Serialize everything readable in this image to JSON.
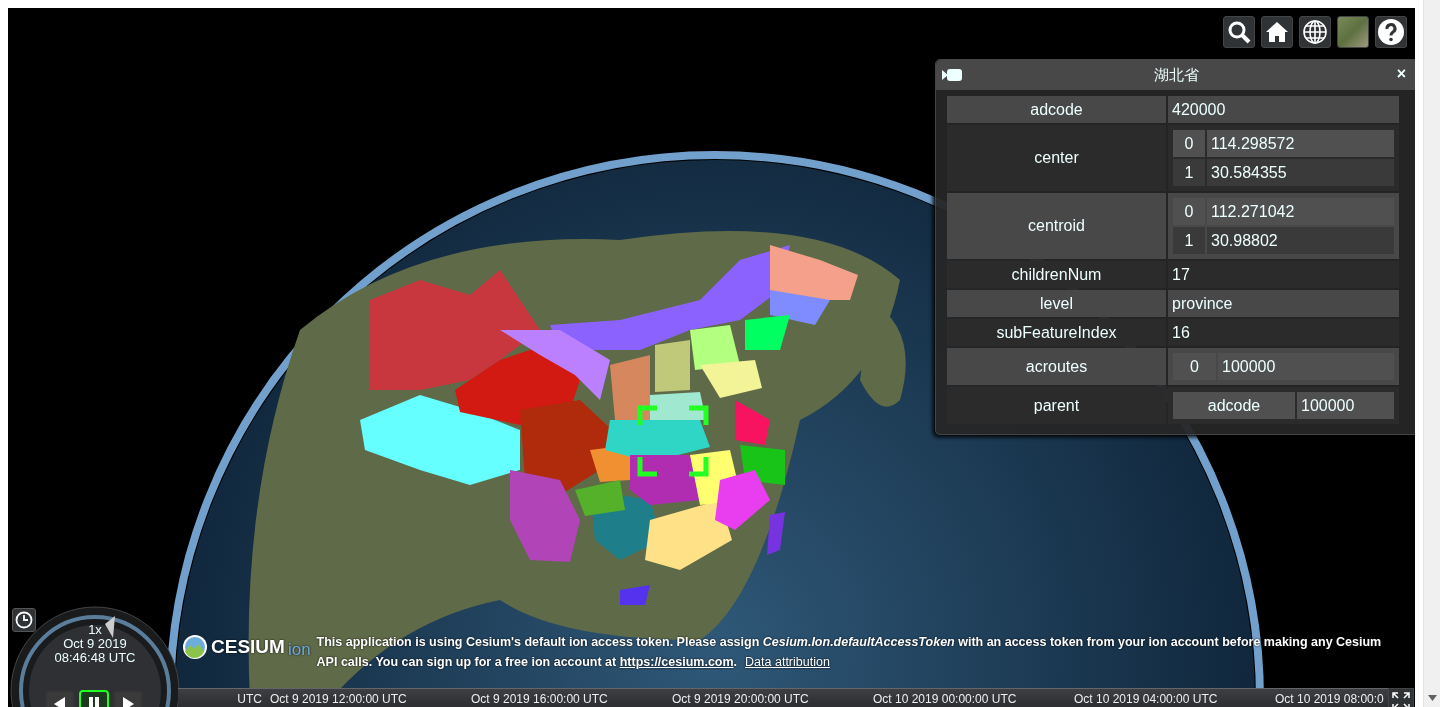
{
  "toolbar": {
    "buttons": [
      {
        "kind": "search"
      },
      {
        "kind": "home"
      },
      {
        "kind": "globe"
      },
      {
        "kind": "imagery"
      },
      {
        "kind": "help"
      }
    ]
  },
  "infobox": {
    "title": "湖北省",
    "close": "×",
    "rows": [
      {
        "kind": "text",
        "key": "adcode",
        "value": "420000"
      },
      {
        "kind": "nested",
        "key": "center",
        "items": [
          {
            "key": "0",
            "value": "114.298572"
          },
          {
            "key": "1",
            "value": "30.584355"
          }
        ]
      },
      {
        "kind": "nested",
        "key": "centroid",
        "items": [
          {
            "key": "0",
            "value": "112.271042"
          },
          {
            "key": "1",
            "value": "30.98802"
          }
        ]
      },
      {
        "kind": "text",
        "key": "childrenNum",
        "value": "17"
      },
      {
        "kind": "text",
        "key": "level",
        "value": "province"
      },
      {
        "kind": "text",
        "key": "subFeatureIndex",
        "value": "16"
      },
      {
        "kind": "nested",
        "key": "acroutes",
        "items": [
          {
            "key": "0",
            "value": "100000"
          }
        ]
      },
      {
        "kind": "nested",
        "key": "parent",
        "items": [
          {
            "key": "adcode",
            "value": "100000"
          }
        ]
      }
    ]
  },
  "animation": {
    "speed": "1x",
    "date": "Oct 9 2019",
    "time": "08:46:48 UTC",
    "buttons": [
      {
        "kind": "reverse",
        "selected": false
      },
      {
        "kind": "pause",
        "selected": true
      },
      {
        "kind": "play",
        "selected": false
      }
    ]
  },
  "credits": {
    "logo_text": "CESIUM",
    "logo_suffix": "ion",
    "notice": "This application is using Cesium's default ion access token. Please assign *Cesium.Ion.defaultAccessToken* with an access token from your ion account before making any Cesium API calls. You can sign up for a free ion account at ",
    "link": "https://cesium.com",
    "after": ".",
    "attribution": "Data attribution"
  },
  "timeline": {
    "labels": [
      "UTC",
      "Oct 9 2019 12:00:00 UTC",
      "Oct 9 2019 16:00:00 UTC",
      "Oct 9 2019 20:00:00 UTC",
      "Oct 10 2019 00:00:00 UTC",
      "Oct 10 2019 04:00:00 UTC",
      "Oct 10 2019 08:00:0"
    ]
  }
}
